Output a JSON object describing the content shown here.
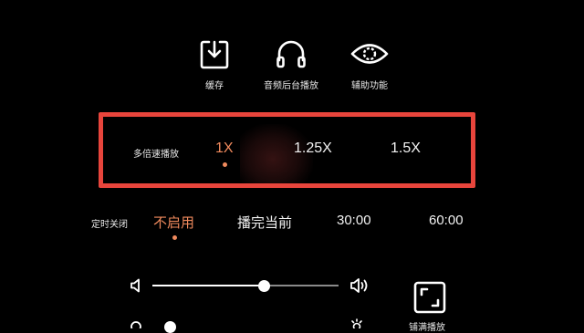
{
  "actions": [
    {
      "label": "缓存",
      "icon": "download-icon"
    },
    {
      "label": "音频后台播放",
      "icon": "headphones-icon"
    },
    {
      "label": "辅助功能",
      "icon": "eye-icon"
    }
  ],
  "speed": {
    "title": "多倍速播放",
    "options": [
      "1X",
      "1.25X",
      "1.5X"
    ],
    "selected": "1X"
  },
  "timer": {
    "title": "定时关闭",
    "options": [
      "不启用",
      "播完当前",
      "30:00",
      "60:00"
    ],
    "selected": "不启用"
  },
  "volume": {
    "level": 0.6,
    "left_icon": "volume-low-icon",
    "right_icon": "volume-high-icon"
  },
  "fullscreen": {
    "label": "铺满播放",
    "icon": "fullscreen-icon"
  },
  "colors": {
    "accent": "#f08a5d",
    "highlight_border": "#e8453c",
    "background": "#000000"
  }
}
